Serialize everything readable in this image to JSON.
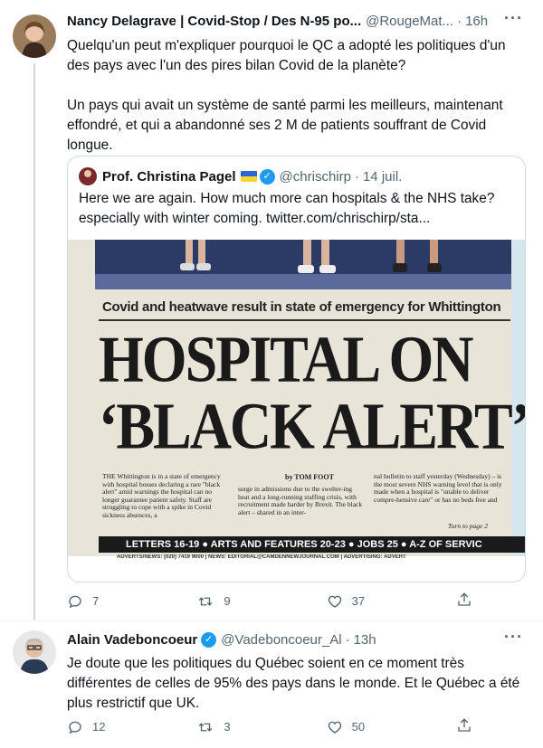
{
  "tweet1": {
    "name": "Nancy Delagrave | Covid-Stop / Des N-95 po...",
    "handle": "@RougeMat...",
    "dot": "·",
    "time": "16h",
    "text_line1": "Quelqu'un peut m'expliquer pourquoi le QC a adopté les politiques d'un des pays avec l'un des pires bilan Covid de la planète?",
    "text_line2": "Un pays qui avait un système de santé parmi les meilleurs, maintenant effondré, et qui a abandonné ses  2 M de patients souffrant de Covid longue.",
    "quote": {
      "name": "Prof. Christina Pagel",
      "handle": "@chrischirp",
      "dot": "·",
      "time": "14 juil.",
      "text": "Here we are again. How much more can hospitals  & the NHS take? especially with winter coming.  twitter.com/chrischirp/sta...",
      "newspaper": {
        "kicker": "Covid and heatwave result in state of emergency for Whittington",
        "headline1": "HOSPITAL ON",
        "headline2": "‘BLACK ALERT’",
        "byline": "by TOM FOOT",
        "col1": "THE Whittington is in a state of emergency with hospital bosses declaring a rare \"black alert\" amid warnings the hospital can no longer guarantee patient safety. Staff are struggling to cope with a spike in Covid sickness absences, a",
        "col2": "surge in admissions due to the swelter-ing heat and a long-running staffing crisis, with recruitment made harder by Brexit. The black alert – shared in an inter-",
        "col3": "nal bulletin to staff yesterday (Wednesday) – is the most severe NHS warning level that is only made when a hospital is \"unable to deliver compre-hensive care\" or has no beds free and",
        "turn": "Turn to page 2",
        "bar1": "LETTERS 16-19",
        "bar2": "ARTS AND FEATURES 20-23",
        "bar3": "JOBS 25",
        "bar4": "A-Z OF SERVIC",
        "footer": "ADVERTS/NEWS: (020) 7419 9000  |  NEWS: EDITORIAL@CAMDENNEWJOURNAL.COM  |  ADVERTISING: ADVERT"
      }
    },
    "replies": "7",
    "retweets": "9",
    "likes": "37"
  },
  "tweet2": {
    "name": "Alain Vadeboncoeur",
    "handle": "@Vadeboncoeur_Al",
    "dot": "·",
    "time": "13h",
    "text": "Je doute que les politiques du Québec soient en ce moment très différentes de celles de 95% des pays dans le monde. Et le Québec a été plus restrictif que UK.",
    "replies": "12",
    "retweets": "3",
    "likes": "50"
  },
  "icons": {
    "more": "more-icon",
    "reply": "reply-icon",
    "retweet": "retweet-icon",
    "like": "heart-icon",
    "share": "share-icon",
    "verified": "verified-badge-icon"
  },
  "colors": {
    "accent": "#1d9bf0",
    "muted": "#536471",
    "border": "#cfd9de"
  }
}
